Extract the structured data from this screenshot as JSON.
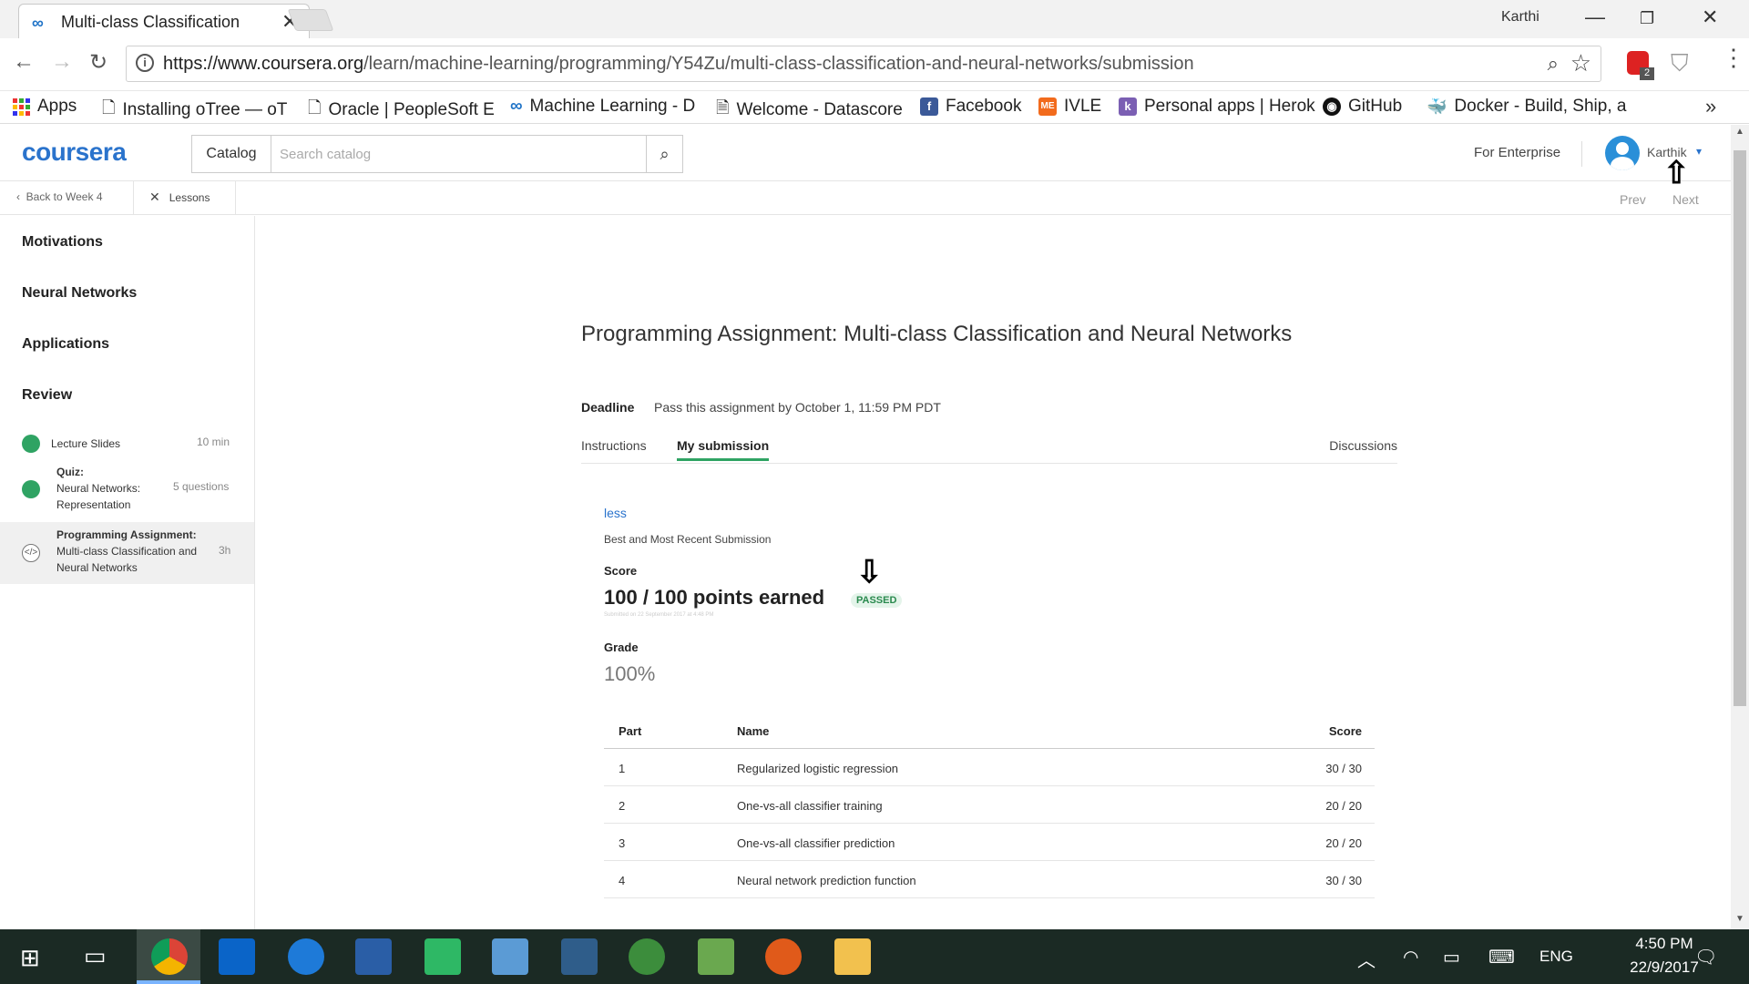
{
  "browser": {
    "tab_title": "Multi-class Classification",
    "tab_close": "✕",
    "window_user": "Karthi",
    "url_host": "https://www.coursera.org",
    "url_path": "/learn/machine-learning/programming/Y54Zu/multi-class-classification-and-neural-networks/submission",
    "extension_badge": "2",
    "bookmarks": [
      {
        "label": "Apps"
      },
      {
        "label": "Installing oTree — oT"
      },
      {
        "label": "Oracle | PeopleSoft E"
      },
      {
        "label": "Machine Learning - D"
      },
      {
        "label": "Welcome - Datascore"
      },
      {
        "label": "Facebook"
      },
      {
        "label": "IVLE"
      },
      {
        "label": "Personal apps | Herok"
      },
      {
        "label": "GitHub"
      },
      {
        "label": "Docker - Build, Ship, a"
      }
    ]
  },
  "header": {
    "logo": "coursera",
    "catalog_label": "Catalog",
    "search_placeholder": "Search catalog",
    "for_enterprise": "For Enterprise",
    "user_name": "Karthik"
  },
  "subnav": {
    "back_label": "Back to Week 4",
    "lessons_label": "Lessons",
    "prev_label": "Prev",
    "next_label": "Next"
  },
  "sidebar": {
    "sections": [
      "Motivations",
      "Neural Networks",
      "Applications",
      "Review"
    ],
    "items": [
      {
        "type": "",
        "title": "Lecture Slides",
        "meta": "10 min"
      },
      {
        "type": "Quiz:",
        "title": "Neural Networks: Representation",
        "meta": "5 questions"
      },
      {
        "type": "Programming Assignment:",
        "title": "Multi-class Classification and Neural Networks",
        "meta": "3h"
      }
    ]
  },
  "main": {
    "title": "Programming Assignment: Multi-class Classification and Neural Networks",
    "deadline_label": "Deadline",
    "deadline_text": "Pass this assignment by October 1, 11:59 PM PDT",
    "tabs": {
      "instructions": "Instructions",
      "my_submission": "My submission",
      "discussions": "Discussions"
    },
    "less_link": "less",
    "best_recent": "Best and Most Recent Submission",
    "score_label": "Score",
    "points": "100 / 100 points earned",
    "status": "PASSED",
    "submitted": "Submitted on 22 September 2017 at 4:48 PM",
    "grade_label": "Grade",
    "grade": "100%",
    "table": {
      "headers": [
        "Part",
        "Name",
        "Score"
      ],
      "rows": [
        [
          "1",
          "Regularized logistic regression",
          "30 / 30"
        ],
        [
          "2",
          "One-vs-all classifier training",
          "20 / 20"
        ],
        [
          "3",
          "One-vs-all classifier prediction",
          "20 / 20"
        ],
        [
          "4",
          "Neural network prediction function",
          "30 / 30"
        ]
      ]
    }
  },
  "taskbar": {
    "lang": "ENG",
    "time": "4:50 PM",
    "date": "22/9/2017"
  }
}
